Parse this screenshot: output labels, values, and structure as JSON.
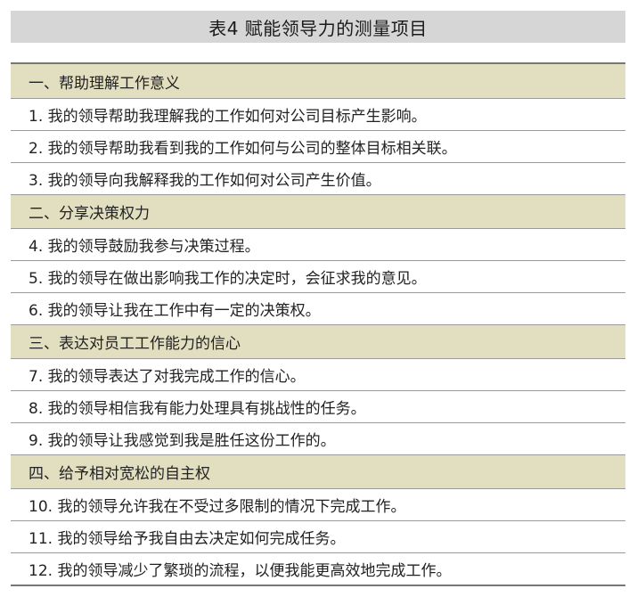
{
  "title": "表4  赋能领导力的测量项目",
  "sections": [
    {
      "heading": "一、帮助理解工作意义",
      "items": [
        "1. 我的领导帮助我理解我的工作如何对公司目标产生影响。",
        "2. 我的领导帮助我看到我的工作如何与公司的整体目标相关联。",
        "3. 我的领导向我解释我的工作如何对公司产生价值。"
      ]
    },
    {
      "heading": "二、分享决策权力",
      "items": [
        "4. 我的领导鼓励我参与决策过程。",
        "5. 我的领导在做出影响我工作的决定时，会征求我的意见。",
        "6. 我的领导让我在工作中有一定的决策权。"
      ]
    },
    {
      "heading": "三、表达对员工工作能力的信心",
      "items": [
        "7. 我的领导表达了对我完成工作的信心。",
        "8. 我的领导相信我有能力处理具有挑战性的任务。",
        "9. 我的领导让我感觉到我是胜任这份工作的。"
      ]
    },
    {
      "heading": "四、给予相对宽松的自主权",
      "items": [
        "10. 我的领导允许我在不受过多限制的情况下完成工作。",
        "11. 我的领导给予我自由去决定如何完成任务。",
        "12. 我的领导减少了繁琐的流程，以便我能更高效地完成工作。"
      ]
    }
  ],
  "colors": {
    "title_background": "#d6d6d6",
    "section_background": "#e2dfc0",
    "rule_color": "#777777"
  }
}
